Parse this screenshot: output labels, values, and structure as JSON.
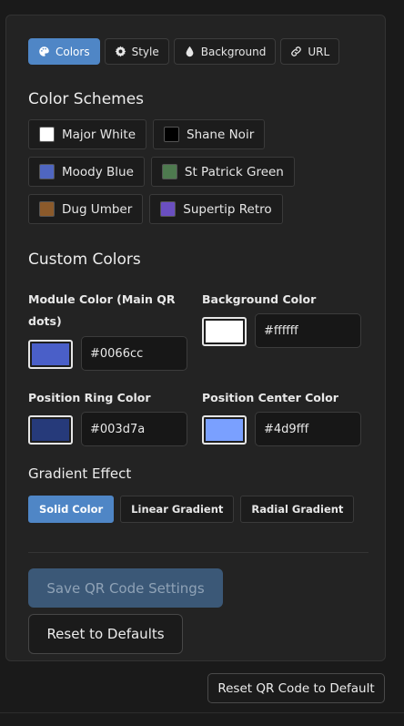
{
  "tabs": [
    {
      "label": "Colors",
      "icon": "palette-icon",
      "active": true
    },
    {
      "label": "Style",
      "icon": "gear-icon",
      "active": false
    },
    {
      "label": "Background",
      "icon": "droplet-icon",
      "active": false
    },
    {
      "label": "URL",
      "icon": "link-icon",
      "active": false
    }
  ],
  "color_schemes": {
    "heading": "Color Schemes",
    "items": [
      {
        "label": "Major White",
        "color": "#ffffff"
      },
      {
        "label": "Shane Noir",
        "color": "#000000"
      },
      {
        "label": "Moody Blue",
        "color": "#4f66c0"
      },
      {
        "label": "St Patrick Green",
        "color": "#4e7a4f"
      },
      {
        "label": "Dug Umber",
        "color": "#8b5a2b"
      },
      {
        "label": "Supertip Retro",
        "color": "#6a4fc0"
      }
    ]
  },
  "custom_colors": {
    "heading": "Custom Colors",
    "module": {
      "label": "Module Color (Main QR dots)",
      "value": "#0066cc",
      "swatch": "#4a5fc8"
    },
    "background": {
      "label": "Background Color",
      "value": "#ffffff",
      "swatch": "#ffffff"
    },
    "position_ring": {
      "label": "Position Ring Color",
      "value": "#003d7a",
      "swatch": "#263a7a"
    },
    "position_center": {
      "label": "Position Center Color",
      "value": "#4d9fff",
      "swatch": "#7aa0ff"
    }
  },
  "gradient": {
    "heading": "Gradient Effect",
    "options": [
      {
        "label": "Solid Color",
        "active": true
      },
      {
        "label": "Linear Gradient",
        "active": false
      },
      {
        "label": "Radial Gradient",
        "active": false
      }
    ]
  },
  "actions": {
    "save_label": "Save QR Code Settings",
    "reset_label": "Reset to Defaults",
    "reset_qr_label": "Reset QR Code to Default"
  }
}
